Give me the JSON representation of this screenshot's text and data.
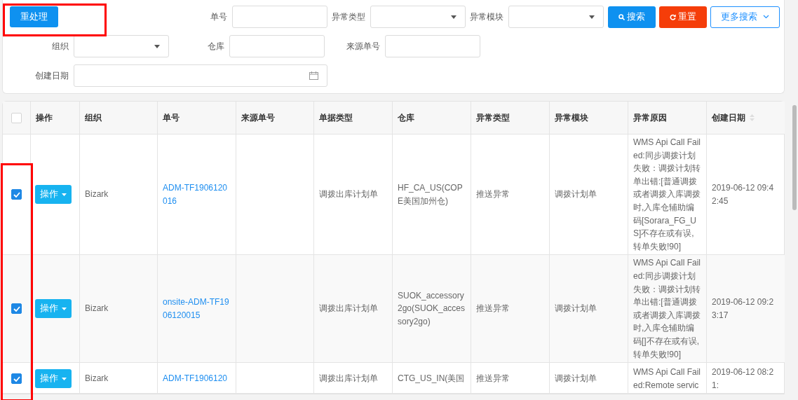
{
  "toolbar": {
    "reprocess_button": "重处理"
  },
  "filters": [
    {
      "kind": "input",
      "label": "单号"
    },
    {
      "kind": "select",
      "label": "异常类型"
    },
    {
      "kind": "select",
      "label": "异常模块"
    },
    {
      "kind": "select",
      "label": "组织"
    },
    {
      "kind": "input",
      "label": "仓库"
    },
    {
      "kind": "input",
      "label": "来源单号"
    },
    {
      "kind": "date",
      "label": "创建日期"
    }
  ],
  "actions": [
    {
      "kind": "search",
      "label": "搜索"
    },
    {
      "kind": "reset",
      "label": "重置"
    },
    {
      "kind": "more",
      "label": "更多搜索"
    }
  ],
  "table": {
    "select_all": false,
    "columns": [
      {
        "label": "操作",
        "sortable": false
      },
      {
        "label": "组织",
        "sortable": false
      },
      {
        "label": "单号",
        "sortable": false
      },
      {
        "label": "来源单号",
        "sortable": false
      },
      {
        "label": "单据类型",
        "sortable": false
      },
      {
        "label": "仓库",
        "sortable": false
      },
      {
        "label": "异常类型",
        "sortable": false
      },
      {
        "label": "异常模块",
        "sortable": false
      },
      {
        "label": "异常原因",
        "sortable": false
      },
      {
        "label": "创建日期",
        "sortable": true
      }
    ],
    "rows": [
      {
        "selected": true,
        "action": "操作",
        "org": "Bizark",
        "number": "ADM-TF1906120016",
        "source": "",
        "doc_type": "调拨出库计划单",
        "warehouse": "HF_CA_US(COPE美国加州仓)",
        "error_type": "推送异常",
        "error_module": "调拨计划单",
        "reason": "WMS Api Call Failed:同步调拨计划失败：调拨计划转单出错:[普通调拨或者调拨入库调拨时,入库仓辅助编码[Sorara_FG_US]不存在或有误,转单失败!90]",
        "created": "2019-06-12 09:42:45"
      },
      {
        "selected": true,
        "action": "操作",
        "org": "Bizark",
        "number": "onsite-ADM-TF1906120015",
        "source": "",
        "doc_type": "调拨出库计划单",
        "warehouse": "SUOK_accessory2go(SUOK_accessory2go)",
        "error_type": "推送异常",
        "error_module": "调拨计划单",
        "reason": "WMS Api Call Failed:同步调拨计划失败：调拨计划转单出错:[普通调拨或者调拨入库调拨时,入库仓辅助编码[]不存在或有误,转单失败!90]",
        "created": "2019-06-12 09:23:17"
      },
      {
        "selected": true,
        "action": "操作",
        "org": "Bizark",
        "number": "ADM-TF1906120",
        "source": "",
        "doc_type": "调拨出库计划单",
        "warehouse": "CTG_US_IN(美国",
        "error_type": "推送异常",
        "error_module": "调拨计划单",
        "reason": "WMS Api Call Failed:Remote servic",
        "created": "2019-06-12 08:21:"
      }
    ]
  }
}
